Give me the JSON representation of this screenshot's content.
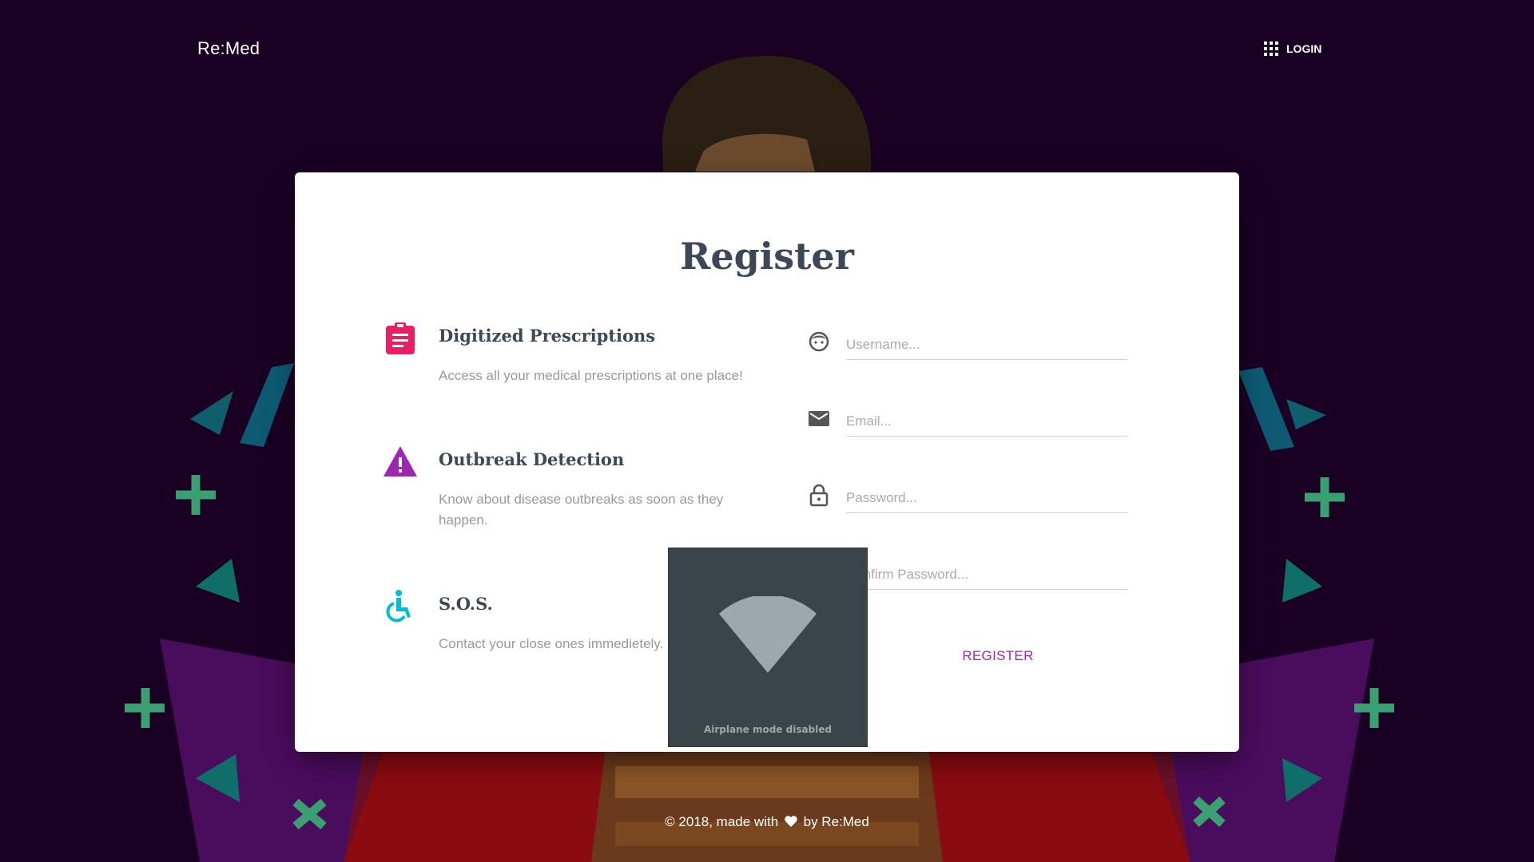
{
  "app": {
    "brand": "Re:Med"
  },
  "nav": {
    "login_label": "LOGIN",
    "login_icon": "apps-grid-icon"
  },
  "card": {
    "title": "Register",
    "features": [
      {
        "icon": "clipboard-list-icon",
        "color": "#e91e63",
        "title": "Digitized Prescriptions",
        "text": "Access all your medical prescriptions at one place!"
      },
      {
        "icon": "warning-icon",
        "color": "#9c27b0",
        "title": "Outbreak Detection",
        "text": "Know about disease outbreaks as soon as they happen."
      },
      {
        "icon": "accessible-icon",
        "color": "#00bcd4",
        "title": "S.O.S.",
        "text": "Contact your close ones immedietely."
      }
    ],
    "form": {
      "username_placeholder": "Username...",
      "email_placeholder": "Email...",
      "password_placeholder": "Password...",
      "confirm_placeholder": "Confirm Password...",
      "register_label": "REGISTER"
    }
  },
  "overlay": {
    "label": "Airplane mode disabled",
    "icon": "wifi-signal-icon"
  },
  "footer": {
    "prefix": "© 2018, made with",
    "suffix": "by Re:Med",
    "heart_icon": "heart-icon"
  },
  "colors": {
    "background": "#1a0124",
    "accent": "#9c27b0",
    "card": "#ffffff"
  }
}
